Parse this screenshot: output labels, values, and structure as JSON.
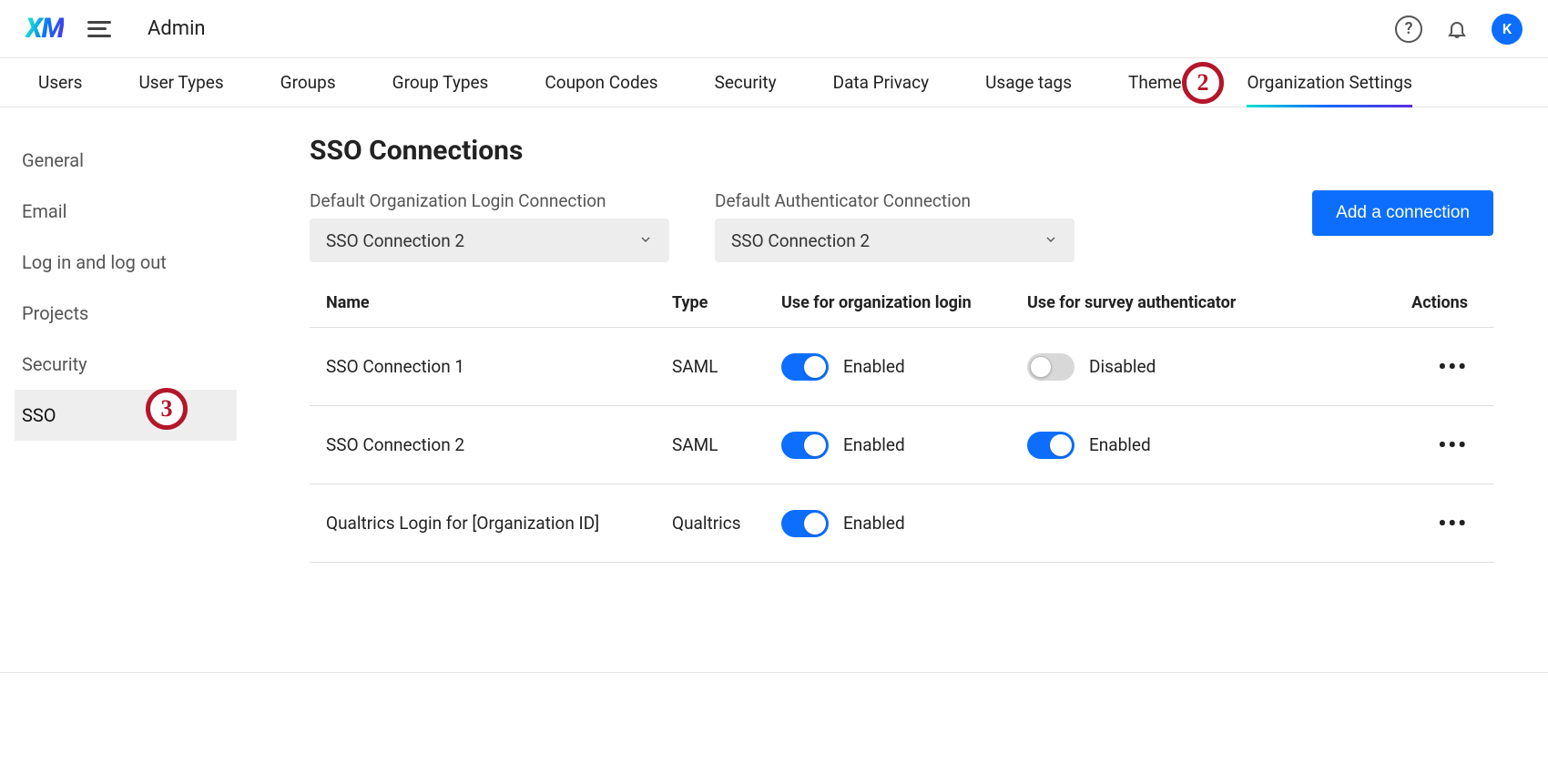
{
  "header": {
    "logo_text": "XM",
    "page_label": "Admin",
    "avatar_initial": "K",
    "help_glyph": "?"
  },
  "nav": {
    "tabs": [
      {
        "label": "Users"
      },
      {
        "label": "User Types"
      },
      {
        "label": "Groups"
      },
      {
        "label": "Group Types"
      },
      {
        "label": "Coupon Codes"
      },
      {
        "label": "Security"
      },
      {
        "label": "Data Privacy"
      },
      {
        "label": "Usage tags"
      },
      {
        "label": "Themes"
      },
      {
        "label": "Organization Settings"
      }
    ],
    "active_index": 9
  },
  "sidebar": {
    "items": [
      {
        "label": "General"
      },
      {
        "label": "Email"
      },
      {
        "label": "Log in and log out"
      },
      {
        "label": "Projects"
      },
      {
        "label": "Security"
      },
      {
        "label": "SSO"
      }
    ],
    "active_index": 5
  },
  "main": {
    "title": "SSO Connections",
    "default_org_label": "Default Organization Login Connection",
    "default_org_value": "SSO Connection 2",
    "default_auth_label": "Default Authenticator Connection",
    "default_auth_value": "SSO Connection 2",
    "add_button": "Add a connection",
    "table": {
      "headers": {
        "name": "Name",
        "type": "Type",
        "org_login": "Use for organization login",
        "survey_auth": "Use for survey authenticator",
        "actions": "Actions"
      },
      "rows": [
        {
          "name": "SSO Connection 1",
          "type": "SAML",
          "org_login_enabled": true,
          "org_login_label": "Enabled",
          "survey_auth_present": true,
          "survey_auth_enabled": false,
          "survey_auth_label": "Disabled"
        },
        {
          "name": "SSO Connection 2",
          "type": "SAML",
          "org_login_enabled": true,
          "org_login_label": "Enabled",
          "survey_auth_present": true,
          "survey_auth_enabled": true,
          "survey_auth_label": "Enabled"
        },
        {
          "name": "Qualtrics Login for [Organization ID]",
          "type": "Qualtrics",
          "org_login_enabled": true,
          "org_login_label": "Enabled",
          "survey_auth_present": false
        }
      ]
    }
  },
  "annotations": {
    "a2": "2",
    "a3": "3"
  }
}
